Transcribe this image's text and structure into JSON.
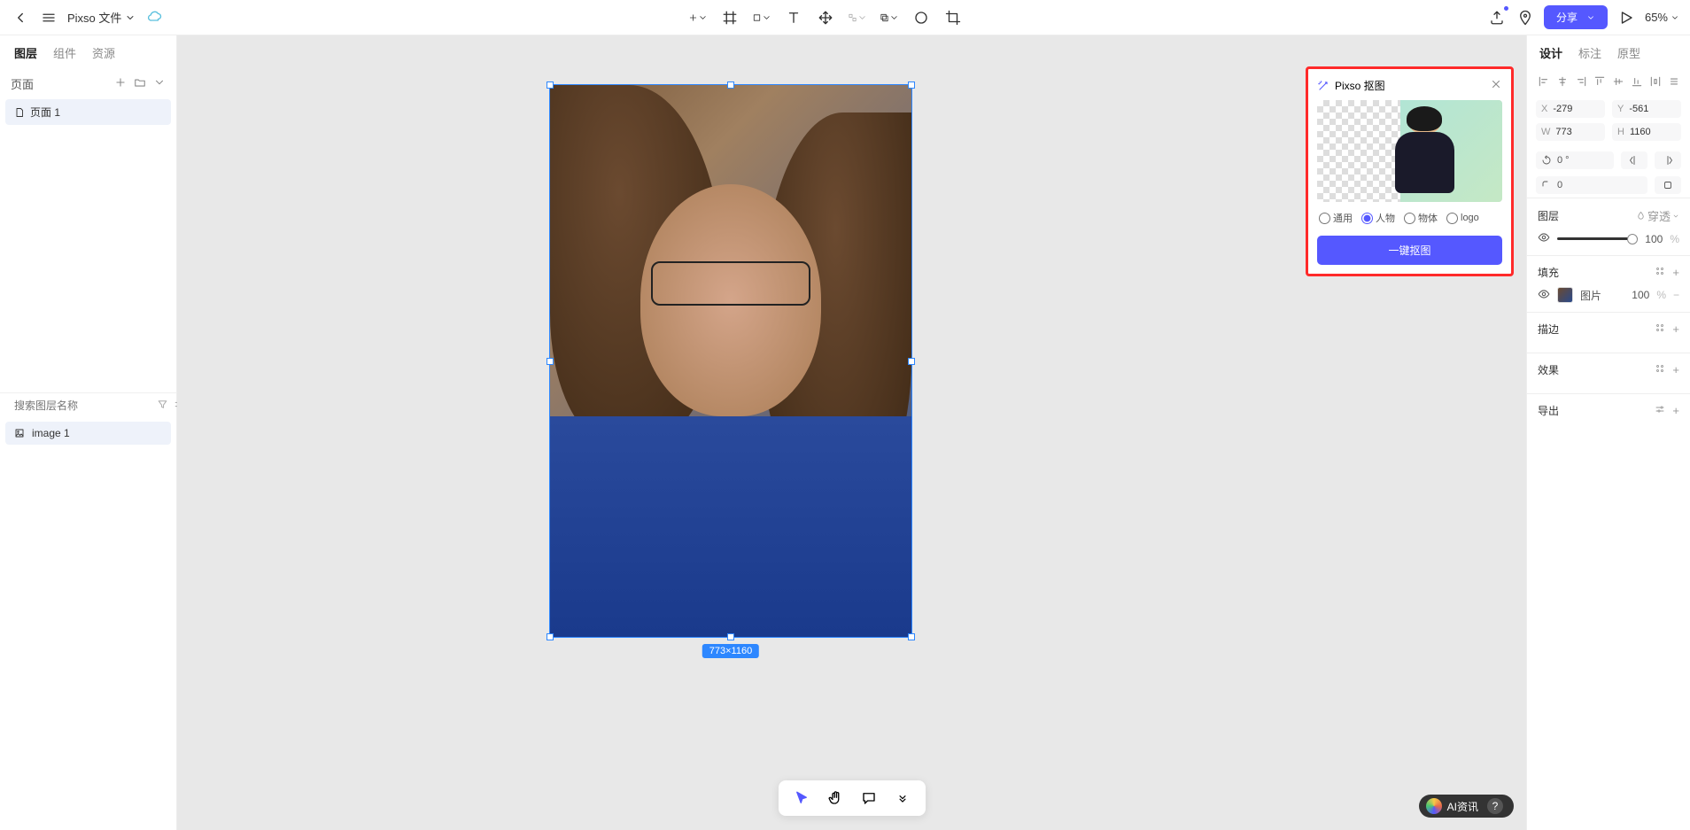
{
  "header": {
    "file_name": "Pixso 文件",
    "share_label": "分享",
    "zoom": "65%"
  },
  "left_panel": {
    "tabs": [
      "图层",
      "组件",
      "资源"
    ],
    "pages_label": "页面",
    "page_1": "页面 1",
    "search_placeholder": "搜索图层名称",
    "layer_1": "image 1"
  },
  "canvas": {
    "size_badge": "773×1160"
  },
  "koutu": {
    "title": "Pixso 抠图",
    "radio_general": "通用",
    "radio_person": "人物",
    "radio_object": "物体",
    "radio_logo": "logo",
    "action": "一键抠图"
  },
  "right_panel": {
    "tabs": [
      "设计",
      "标注",
      "原型"
    ],
    "x_label": "X",
    "x_val": "-279",
    "y_label": "Y",
    "y_val": "-561",
    "w_label": "W",
    "w_val": "773",
    "h_label": "H",
    "h_val": "1160",
    "rot_label": "0 °",
    "radius_label": "0",
    "layer_section": "图层",
    "passthrough": "穿透",
    "opacity_val": "100",
    "opacity_pct": "%",
    "fill_section": "填充",
    "fill_label": "图片",
    "fill_opacity": "100",
    "stroke_section": "描边",
    "effect_section": "效果",
    "export_section": "导出"
  },
  "watermark": {
    "text": "AI资讯"
  }
}
